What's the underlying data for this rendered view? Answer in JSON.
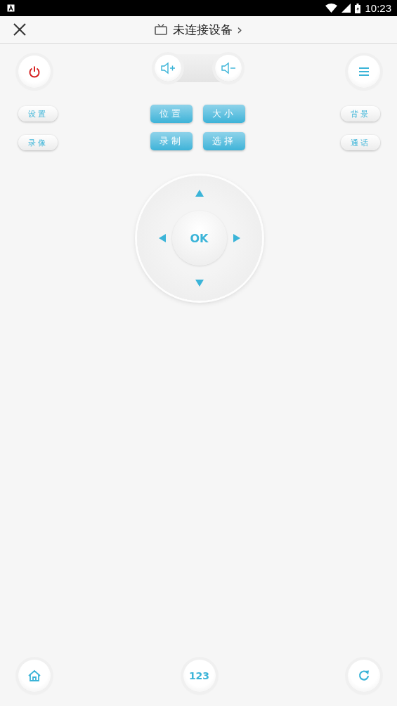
{
  "status_bar": {
    "time": "10:23"
  },
  "header": {
    "title": "未连接设备",
    "chevron": "›"
  },
  "side_buttons_left": [
    "设置",
    "录像"
  ],
  "function_buttons": [
    "位置",
    "大小",
    "录制",
    "选择"
  ],
  "side_buttons_right": [
    "背景",
    "通话"
  ],
  "dpad": {
    "ok_label": "OK"
  },
  "keypad_button": {
    "label": "123"
  }
}
